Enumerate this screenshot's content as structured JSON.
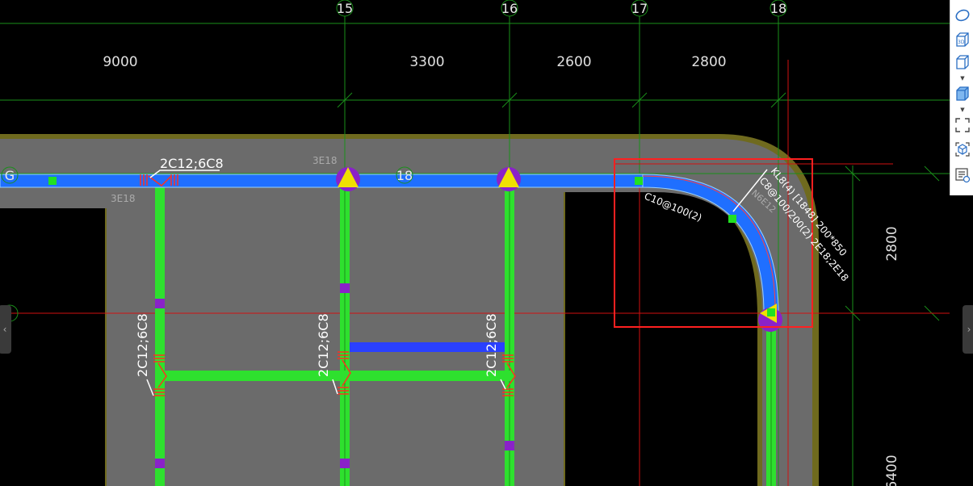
{
  "grid": {
    "axis_labels": [
      "15",
      "16",
      "17",
      "18"
    ],
    "row_labels": [
      "G",
      "18"
    ],
    "top_dimensions": [
      "9000",
      "3300",
      "2600",
      "2800"
    ],
    "right_dimensions": [
      "2800",
      "6400"
    ]
  },
  "annotations": {
    "beam_rebar_label": "2C12;6C8",
    "column_rebar_label": "2C12;6C8",
    "top_rebar_a": "3E18",
    "top_rebar_b": "3E18",
    "curved_beam_line1": "KL8(4) [1848] 200*850",
    "curved_beam_line2": "C8@100/200(2) 2E18;2E18",
    "curved_beam_side": "N6E12",
    "curved_beam_stirrup": "C10@100(2)"
  },
  "colors": {
    "background": "#000000",
    "slab": "#6b6b6b",
    "slab_edge": "#6f6a1e",
    "beam_blue": "#1f6fff",
    "beam_green": "#2ee02e",
    "grid_line": "#1a8f1a",
    "red_line": "#d01010",
    "selection_box": "#ff2020",
    "column_marker": "#8a22c8",
    "triangle": "#f0e000"
  },
  "toolbar": {
    "items": [
      {
        "icon": "layer-shape-icon"
      },
      {
        "icon": "3d-view-icon",
        "label": "3D"
      },
      {
        "icon": "box-view-icon"
      },
      {
        "icon": "solid-box-icon"
      },
      {
        "icon": "fullscreen-icon"
      },
      {
        "icon": "isometric-view-icon"
      },
      {
        "icon": "properties-view-icon"
      }
    ]
  },
  "side_handles": {
    "left": "‹",
    "right": "›"
  }
}
